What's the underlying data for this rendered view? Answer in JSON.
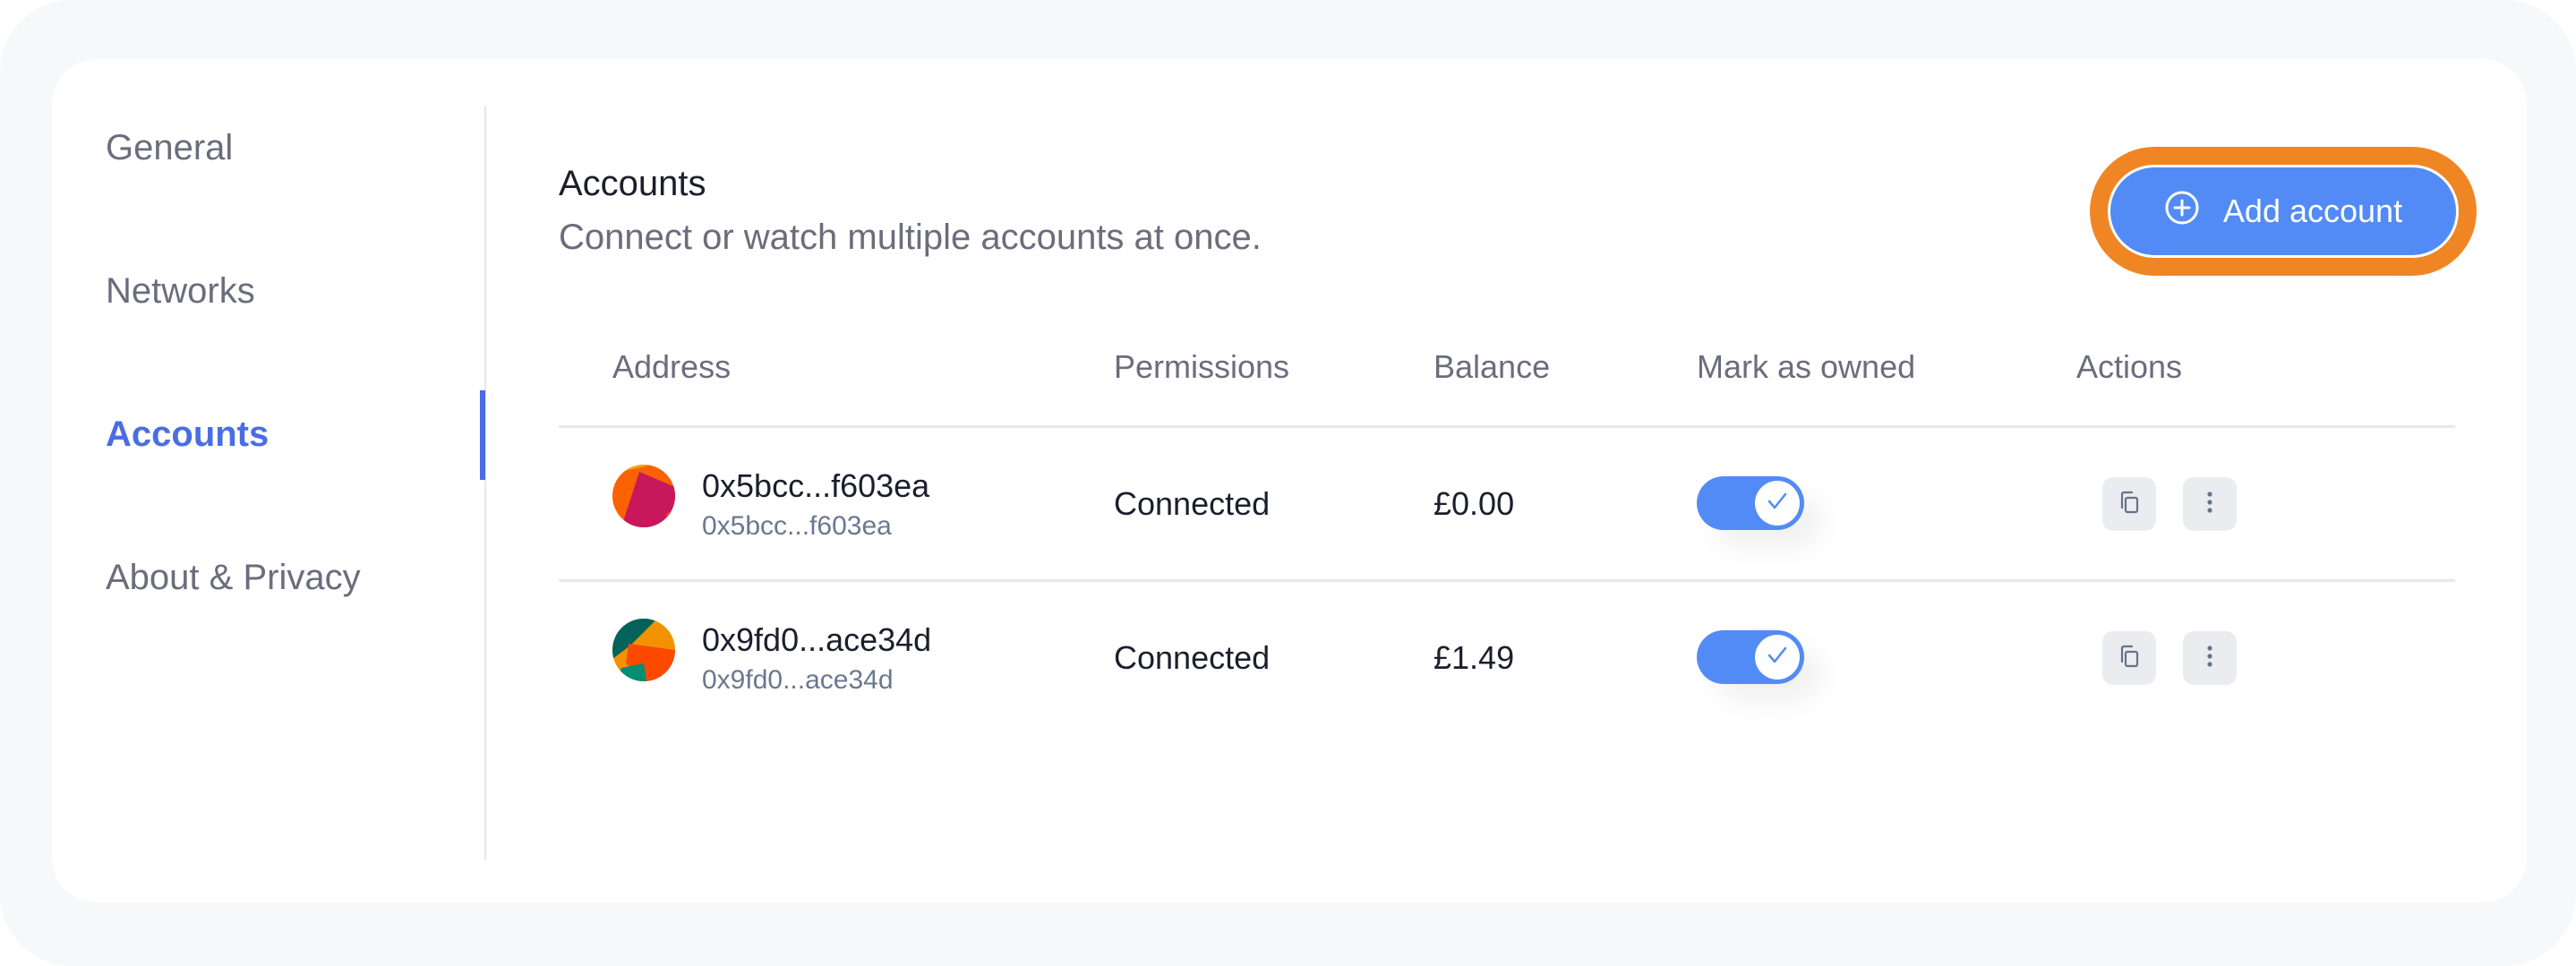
{
  "sidebar": {
    "items": [
      {
        "label": "General",
        "active": false
      },
      {
        "label": "Networks",
        "active": false
      },
      {
        "label": "Accounts",
        "active": true
      },
      {
        "label": "About & Privacy",
        "active": false
      }
    ]
  },
  "section": {
    "title": "Accounts",
    "subtitle": "Connect or watch multiple accounts at once.",
    "add_button_label": "Add account",
    "add_button_icon": "plus-circle-icon"
  },
  "table": {
    "headers": [
      "Address",
      "Permissions",
      "Balance",
      "Mark as owned",
      "Actions"
    ],
    "rows": [
      {
        "address": "0x5bcc...f603ea",
        "address_sub": "0x5bcc...f603ea",
        "permission": "Connected",
        "balance": "£0.00",
        "owned": true
      },
      {
        "address": "0x9fd0...ace34d",
        "address_sub": "0x9fd0...ace34d",
        "permission": "Connected",
        "balance": "£1.49",
        "owned": true
      }
    ],
    "action_icons": [
      "copy-icon",
      "more-vertical-icon"
    ]
  },
  "colors": {
    "accent": "#4A6DE5",
    "button_blue": "#528BF5",
    "highlight_orange": "#F08623",
    "text_primary": "#1C1E2C",
    "text_secondary": "#6B6D7C"
  }
}
